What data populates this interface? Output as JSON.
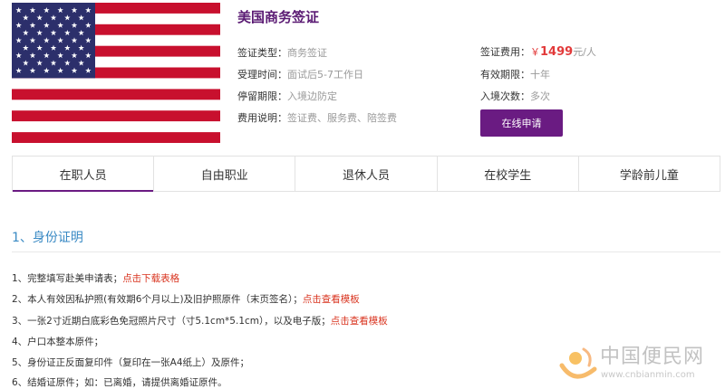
{
  "product": {
    "title": "美国商务签证",
    "flag": "us-flag"
  },
  "details": {
    "visa_type": {
      "label": "签证类型：",
      "value": "商务签证"
    },
    "processing_time": {
      "label": "受理时间：",
      "value": "面试后5-7工作日"
    },
    "stay_period": {
      "label": "停留期限：",
      "value": "入境边防定"
    },
    "fee_note": {
      "label": "费用说明：",
      "value": "签证费、服务费、陪签费"
    },
    "visa_fee": {
      "label": "签证费用：",
      "currency": "￥",
      "amount": "1499",
      "unit": "元/人"
    },
    "validity": {
      "label": "有效期限：",
      "value": "十年"
    },
    "entries": {
      "label": "入境次数：",
      "value": "多次"
    }
  },
  "apply_button": {
    "label": "在线申请"
  },
  "tabs": [
    {
      "label": "在职人员",
      "active": true
    },
    {
      "label": "自由职业",
      "active": false
    },
    {
      "label": "退休人员",
      "active": false
    },
    {
      "label": "在校学生",
      "active": false
    },
    {
      "label": "学龄前儿童",
      "active": false
    }
  ],
  "section": {
    "title": "1、身份证明"
  },
  "requirements": [
    {
      "text": "1、完整填写赴美申请表；",
      "link": "点击下载表格",
      "tail": ""
    },
    {
      "text": "2、本人有效因私护照(有效期6个月以上)及旧护照原件（末页签名）；",
      "link": "点击查看模板",
      "tail": ""
    },
    {
      "text": "3、一张2寸近期白底彩色免冠照片尺寸（寸5.1cm*5.1cm），以及电子版；",
      "link": "点击查看模板",
      "tail": ""
    },
    {
      "text": "4、户口本整本原件；",
      "link": "",
      "tail": ""
    },
    {
      "text": "5、身份证正反面复印件（复印在一张A4纸上）及原件；",
      "link": "",
      "tail": ""
    },
    {
      "text": "6、结婚证原件；如：已离婚，请提供离婚证原件。",
      "link": "",
      "tail": ""
    }
  ],
  "watermark": {
    "name": "中国便民网",
    "url": "www.cnbianmin.com"
  },
  "colors": {
    "accent": "#6a1b82",
    "price": "#e23a3a",
    "link": "#d9341f",
    "section": "#3a8ac4"
  }
}
